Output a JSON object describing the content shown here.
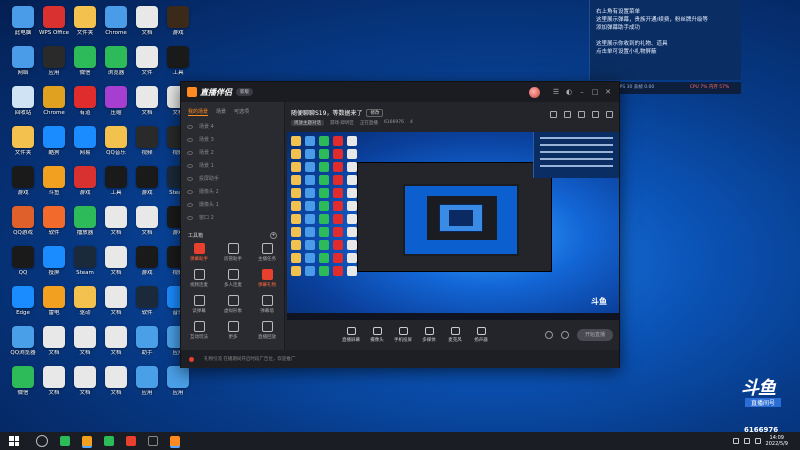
{
  "notification": {
    "lines": [
      "右上角有设置菜单",
      "这里展示弹幕，贵族开通/续费，粉丝牌升级等",
      "添加弹幕助手成功"
    ],
    "lines2": [
      "这里展示你收到的礼物、道具",
      "点击单可设置小礼物屏蔽"
    ]
  },
  "status_bar": {
    "left": "码率 0kb/s  FPS 30  丢帧 0.00",
    "right": "CPU 7%  内存 57%"
  },
  "app": {
    "title": "直播伴侣",
    "version": "新版",
    "tabs": [
      "我的场景",
      "场景",
      "可选项"
    ],
    "active_tab": 0,
    "scenes": [
      "场景 4",
      "场景 3",
      "场景 2",
      "场景 1",
      "投屏助手",
      "摄像头 2",
      "摄像头 1",
      "窗口 2"
    ],
    "tools_title": "工具箱",
    "tools": [
      {
        "label": "弹幕助手",
        "hot": true
      },
      {
        "label": "房管助手",
        "hot": false
      },
      {
        "label": "主播任务",
        "hot": false
      },
      {
        "label": "视频连麦",
        "hot": false
      },
      {
        "label": "多人连麦",
        "hot": false
      },
      {
        "label": "弹幕礼物",
        "hot": true
      },
      {
        "label": "读弹幕",
        "hot": false
      },
      {
        "label": "虚拟形象",
        "hot": false
      },
      {
        "label": "弹幕墙",
        "hot": false
      },
      {
        "label": "互动玩法",
        "hot": false
      },
      {
        "label": "更多",
        "hot": false
      },
      {
        "label": "直播回放",
        "hot": false
      }
    ],
    "topic": "随便聊聊S19，等数据来了",
    "topic_edit": "修改",
    "topic_meta": [
      "周放主题对话",
      "游戏·即听区",
      "正在直播",
      "6166976",
      "4"
    ],
    "bottom_items": [
      "直播屏幕",
      "摄像头",
      "手机投屏",
      "多媒体",
      "麦克风",
      "扬声器"
    ],
    "live_button": "开始直播",
    "footer_text": "礼物引流    在播期间开启时段广告位，欢迎推广"
  },
  "watermark": {
    "brand": "斗鱼",
    "sub": "直播间号",
    "room_id": "6166976"
  },
  "taskbar": {
    "time": "14:09",
    "date": "2022/5/9"
  },
  "desktop_icons": [
    {
      "label": "此电脑",
      "color": "#4a9be8"
    },
    {
      "label": "WPS Office",
      "color": "#d93030"
    },
    {
      "label": "文件夹",
      "color": "#f2c14e"
    },
    {
      "label": "Chrome",
      "color": "#4a9be8"
    },
    {
      "label": "文档",
      "color": "#e8e8e8"
    },
    {
      "label": "游戏",
      "color": "#3b2a1a"
    },
    {
      "label": "网络",
      "color": "#4a9be8"
    },
    {
      "label": "应用",
      "color": "#2a2a2a"
    },
    {
      "label": "微信",
      "color": "#2dbb5a"
    },
    {
      "label": "浏览器",
      "color": "#2dbb5a"
    },
    {
      "label": "文件",
      "color": "#e8e8e8"
    },
    {
      "label": "工具",
      "color": "#1a1a1a"
    },
    {
      "label": "回收站",
      "color": "#cfe3f5"
    },
    {
      "label": "Chrome",
      "color": "#e0a020"
    },
    {
      "label": "有道",
      "color": "#e02c2c"
    },
    {
      "label": "压缩",
      "color": "#a63ed0"
    },
    {
      "label": "文档",
      "color": "#e8e8e8"
    },
    {
      "label": "文档",
      "color": "#e8e8e8"
    },
    {
      "label": "文件夹",
      "color": "#f2c14e"
    },
    {
      "label": "酷狗",
      "color": "#1a8cff"
    },
    {
      "label": "网易",
      "color": "#1a8cff"
    },
    {
      "label": "QQ音乐",
      "color": "#f2c14e"
    },
    {
      "label": "视频",
      "color": "#2a2a2a"
    },
    {
      "label": "视频",
      "color": "#2a2a2a"
    },
    {
      "label": "游戏",
      "color": "#1a1a1a"
    },
    {
      "label": "斗鱼",
      "color": "#f2a020"
    },
    {
      "label": "游戏",
      "color": "#d93030"
    },
    {
      "label": "工具",
      "color": "#1a1a1a"
    },
    {
      "label": "游戏",
      "color": "#1a1a1a"
    },
    {
      "label": "Steam",
      "color": "#1a2a3a"
    },
    {
      "label": "QQ游戏",
      "color": "#e0602c"
    },
    {
      "label": "软件",
      "color": "#f26a2c"
    },
    {
      "label": "播放器",
      "color": "#2dbb5a"
    },
    {
      "label": "文档",
      "color": "#e8e8e8"
    },
    {
      "label": "文档",
      "color": "#e8e8e8"
    },
    {
      "label": "游戏",
      "color": "#1a1a1a"
    },
    {
      "label": "QQ",
      "color": "#1a1a1a"
    },
    {
      "label": "投屏",
      "color": "#1a8cff"
    },
    {
      "label": "Steam",
      "color": "#1a2a3a"
    },
    {
      "label": "文档",
      "color": "#e8e8e8"
    },
    {
      "label": "游戏",
      "color": "#1a1a1a"
    },
    {
      "label": "视频",
      "color": "#1a1a1a"
    },
    {
      "label": "Edge",
      "color": "#1a8cff"
    },
    {
      "label": "雷电",
      "color": "#f2a020"
    },
    {
      "label": "驱动",
      "color": "#f2c14e"
    },
    {
      "label": "文档",
      "color": "#e8e8e8"
    },
    {
      "label": "软件",
      "color": "#1a2a3a"
    },
    {
      "label": "音乐",
      "color": "#1a8cff"
    },
    {
      "label": "QQ浏览器",
      "color": "#4aa0e8"
    },
    {
      "label": "文档",
      "color": "#e8e8e8"
    },
    {
      "label": "文档",
      "color": "#e8e8e8"
    },
    {
      "label": "文档",
      "color": "#e8e8e8"
    },
    {
      "label": "助手",
      "color": "#4aa0e8"
    },
    {
      "label": "应用",
      "color": "#4aa0e8"
    },
    {
      "label": "微信",
      "color": "#2dbb5a"
    },
    {
      "label": "文档",
      "color": "#e8e8e8"
    },
    {
      "label": "文档",
      "color": "#e8e8e8"
    },
    {
      "label": "文档",
      "color": "#e8e8e8"
    },
    {
      "label": "应用",
      "color": "#4aa0e8"
    },
    {
      "label": "应用",
      "color": "#4aa0e8"
    }
  ]
}
